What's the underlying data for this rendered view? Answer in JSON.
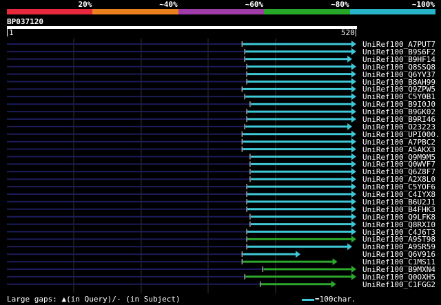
{
  "legend": {
    "labels": [
      "20%",
      "~40%",
      "~60%",
      "~80%",
      "~100%"
    ],
    "colors": [
      "#e8283c",
      "#e9821e",
      "#a03ca8",
      "#28a828",
      "#28b4c8"
    ]
  },
  "query": {
    "name": "BP037120",
    "start": "1",
    "end": "520",
    "length": 520
  },
  "hit_colors": {
    "cyan": "#3ec8d6",
    "green": "#2ca82c",
    "navy": "#1c1c5a",
    "grid": "#30304a"
  },
  "hits": [
    {
      "label": "UniRef100_A7PUT7",
      "start": 351,
      "end": 520,
      "color": "cyan"
    },
    {
      "label": "UniRef100_B9S6F2",
      "start": 355,
      "end": 520,
      "color": "cyan"
    },
    {
      "label": "UniRef100_B9HF14",
      "start": 355,
      "end": 514,
      "color": "cyan"
    },
    {
      "label": "UniRef100_Q8SSQ8",
      "start": 358,
      "end": 520,
      "color": "cyan"
    },
    {
      "label": "UniRef100_Q6YV37",
      "start": 358,
      "end": 520,
      "color": "cyan"
    },
    {
      "label": "UniRef100_B8AH99",
      "start": 358,
      "end": 520,
      "color": "cyan"
    },
    {
      "label": "UniRef100_Q9ZPW5",
      "start": 351,
      "end": 520,
      "color": "cyan"
    },
    {
      "label": "UniRef100_C5Y0B1",
      "start": 355,
      "end": 520,
      "color": "cyan"
    },
    {
      "label": "UniRef100_B9I0J0",
      "start": 363,
      "end": 520,
      "color": "cyan"
    },
    {
      "label": "UniRef100_B9GK02",
      "start": 358,
      "end": 520,
      "color": "cyan"
    },
    {
      "label": "UniRef100_B9RI46",
      "start": 358,
      "end": 520,
      "color": "cyan"
    },
    {
      "label": "UniRef100_O23223",
      "start": 355,
      "end": 514,
      "color": "cyan"
    },
    {
      "label": "UniRef100_UPI000..",
      "start": 351,
      "end": 520,
      "color": "cyan"
    },
    {
      "label": "UniRef100_A7PBC2",
      "start": 351,
      "end": 520,
      "color": "cyan"
    },
    {
      "label": "UniRef100_A5AKX3",
      "start": 351,
      "end": 520,
      "color": "cyan"
    },
    {
      "label": "UniRef100_Q9M9M5",
      "start": 363,
      "end": 520,
      "color": "cyan"
    },
    {
      "label": "UniRef100_Q0WVF7",
      "start": 363,
      "end": 520,
      "color": "cyan"
    },
    {
      "label": "UniRef100_Q6Z8F7",
      "start": 363,
      "end": 520,
      "color": "cyan"
    },
    {
      "label": "UniRef100_A2X8L0",
      "start": 363,
      "end": 520,
      "color": "cyan"
    },
    {
      "label": "UniRef100_C5YOF6",
      "start": 358,
      "end": 520,
      "color": "cyan"
    },
    {
      "label": "UniRef100_C4IYX8",
      "start": 358,
      "end": 520,
      "color": "cyan"
    },
    {
      "label": "UniRef100_B6U2J1",
      "start": 358,
      "end": 520,
      "color": "cyan"
    },
    {
      "label": "UniRef100_B4FHK3",
      "start": 358,
      "end": 520,
      "color": "cyan"
    },
    {
      "label": "UniRef100_Q9LFK8",
      "start": 363,
      "end": 520,
      "color": "cyan"
    },
    {
      "label": "UniRef100_Q8RXI0",
      "start": 363,
      "end": 520,
      "color": "cyan"
    },
    {
      "label": "UniRef100_C4J6T3",
      "start": 358,
      "end": 520,
      "color": "cyan"
    },
    {
      "label": "UniRef100_A9ST98",
      "start": 358,
      "end": 520,
      "color": "green"
    },
    {
      "label": "UniRef100_A9SR59",
      "start": 358,
      "end": 514,
      "color": "cyan"
    },
    {
      "label": "UniRef100_Q6V916",
      "start": 351,
      "end": 437,
      "color": "cyan"
    },
    {
      "label": "UniRef100_C1MS11",
      "start": 351,
      "end": 492,
      "color": "green"
    },
    {
      "label": "UniRef100_B9MXN4",
      "start": 382,
      "end": 520,
      "color": "green"
    },
    {
      "label": "UniRef100_Q0OXH5",
      "start": 355,
      "end": 520,
      "color": "green"
    },
    {
      "label": "UniRef100_C1FGG2",
      "start": 378,
      "end": 490,
      "color": "green"
    }
  ],
  "footer": {
    "gaps_prefix": "Large gaps: ",
    "gaps_symbol": "▲",
    "gaps_text": "(in Query)/- (in Subject)",
    "scale_text": "=100char."
  }
}
